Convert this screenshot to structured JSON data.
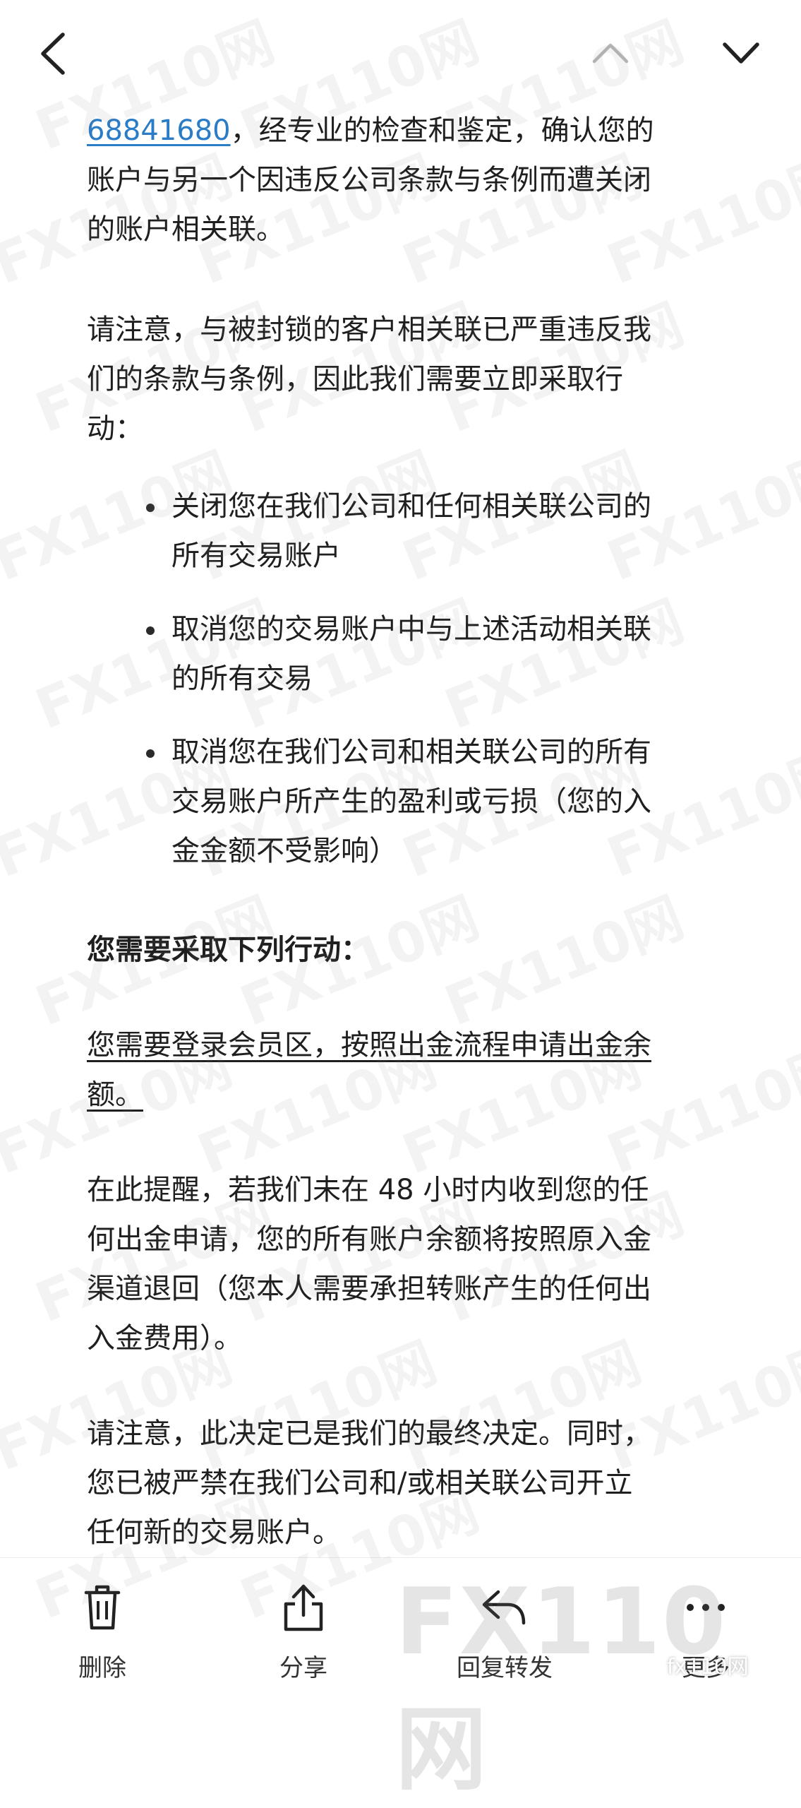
{
  "nav": {
    "back_icon": "chevron-left-icon",
    "prev_icon": "chevron-up-icon",
    "next_icon": "chevron-down-icon"
  },
  "email": {
    "link_number": "68841680",
    "para1_rest_line1": "，经专业的检查和鉴定，确认您的",
    "para1_line2": "账户与另一个因违反公司条款与条例而遭关闭",
    "para1_line3": "的账户相关联。",
    "para2_line1": "请注意，与被封锁的客户相关联已严重违反我",
    "para2_line2": "们的条款与条例，因此我们需要立即采取行",
    "para2_line3": "动：",
    "bullets": [
      {
        "line1": "关闭您在我们公司和任何相关联公司的",
        "line2": "所有交易账户",
        "line3": ""
      },
      {
        "line1": "取消您的交易账户中与上述活动相关联",
        "line2": "的所有交易",
        "line3": ""
      },
      {
        "line1": "取消您在我们公司和相关联公司的所有",
        "line2": "交易账户所产生的盈利或亏损（您的入",
        "line3": "金金额不受影响）"
      }
    ],
    "action_heading": "您需要采取下列行动：",
    "action_line1": "您需要登录会员区，按照出金流程申请出金余",
    "action_line2": "额。",
    "reminder_line1": "在此提醒，若我们未在 48 小时内收到您的任",
    "reminder_line2": "何出金申请，您的所有账户余额将按照原入金",
    "reminder_line3": "渠道退回（您本人需要承担转账产生的任何出",
    "reminder_line4": "入金费用）。",
    "final_line1": "请注意，此决定已是我们的最终决定。同时，",
    "final_line2": "您已被严禁在我们公司和/或相关联公司开立",
    "final_line3": "任何新的交易账户。"
  },
  "toolbar": {
    "delete_label": "删除",
    "share_label": "分享",
    "reply_forward_label": "回复转发",
    "more_label": "更多"
  },
  "watermark": {
    "text": "FX110网",
    "corner_text": "fx110网"
  },
  "colors": {
    "link": "#2a7cc7",
    "text": "#1f1f1f",
    "background": "#ffffff"
  }
}
